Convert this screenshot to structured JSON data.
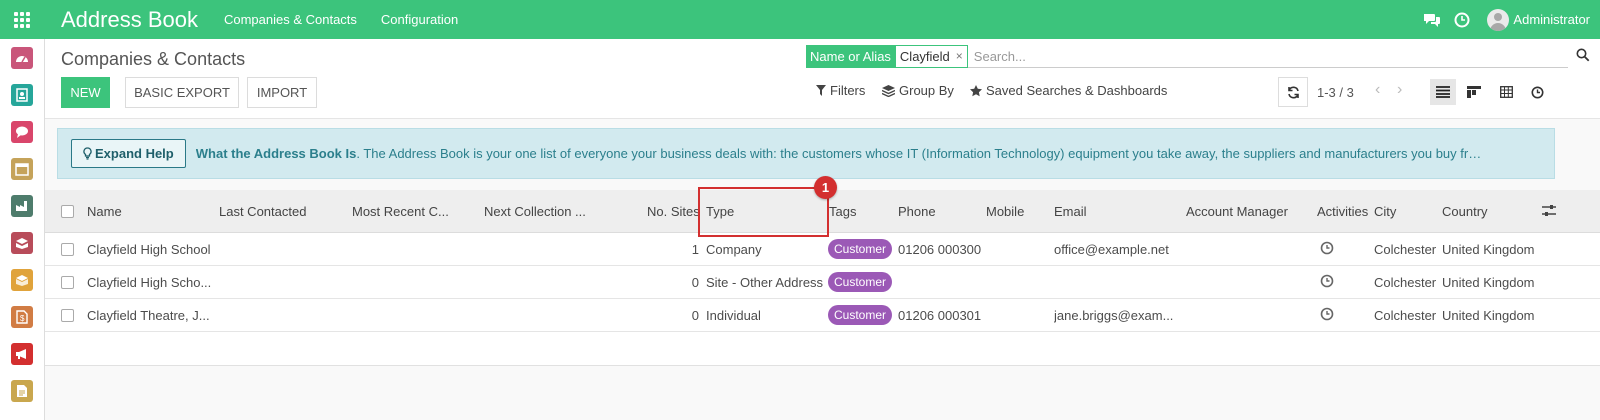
{
  "topbar": {
    "app_title": "Address Book",
    "menu": [
      "Companies & Contacts",
      "Configuration"
    ],
    "user_name": "Administrator"
  },
  "sidebar": {
    "apps": [
      {
        "icon": "dashboard-icon",
        "color": "#c9567a"
      },
      {
        "icon": "contacts-icon",
        "color": "#26a69a"
      },
      {
        "icon": "discuss-icon",
        "color": "#d9466b"
      },
      {
        "icon": "calendar-icon",
        "color": "#c5a35a"
      },
      {
        "icon": "factory-icon",
        "color": "#4e7c6c"
      },
      {
        "icon": "inventory-icon",
        "color": "#b84c5a"
      },
      {
        "icon": "boxes-icon",
        "color": "#e0a33b"
      },
      {
        "icon": "invoice-icon",
        "color": "#d17c44"
      },
      {
        "icon": "megaphone-icon",
        "color": "#d32f2f"
      },
      {
        "icon": "document-icon",
        "color": "#c9a74e"
      }
    ]
  },
  "control_panel": {
    "title": "Companies & Contacts",
    "new_label": "NEW",
    "export_label": "BASIC EXPORT",
    "import_label": "IMPORT",
    "search": {
      "facet_label": "Name or Alias",
      "facet_value": "Clayfield",
      "facet_remove": "×",
      "placeholder": "Search..."
    },
    "filters_label": "Filters",
    "groupby_label": "Group By",
    "saved_label": "Saved Searches & Dashboards",
    "pager_value": "1-3 / 3"
  },
  "help": {
    "button_label": "Expand Help",
    "title": "What the Address Book Is",
    "text": ". The Address Book is your one list of everyone your business deals with: the customers whose IT (Information Technology) equipment you take away, the suppliers and manufacturers you buy from, the couriers who mo..."
  },
  "table": {
    "headers": {
      "name": "Name",
      "last_contacted": "Last Contacted",
      "most_recent": "Most Recent C...",
      "next_collection": "Next Collection ...",
      "no_sites": "No. Sites",
      "type": "Type",
      "tags": "Tags",
      "phone": "Phone",
      "mobile": "Mobile",
      "email": "Email",
      "account_manager": "Account Manager",
      "activities": "Activities",
      "city": "City",
      "country": "Country"
    },
    "rows": [
      {
        "name": "Clayfield High School",
        "no_sites": "1",
        "type": "Company",
        "tag": "Customer",
        "phone": "01206 000300",
        "email": "office@example.net",
        "city": "Colchester",
        "country": "United Kingdom"
      },
      {
        "name": "Clayfield High Scho...",
        "no_sites": "0",
        "type": "Site - Other Address",
        "tag": "Customer",
        "phone": "",
        "email": "",
        "city": "Colchester",
        "country": "United Kingdom"
      },
      {
        "name": "Clayfield Theatre, J...",
        "no_sites": "0",
        "type": "Individual",
        "tag": "Customer",
        "phone": "01206 000301",
        "email": "jane.briggs@exam...",
        "city": "Colchester",
        "country": "United Kingdom"
      }
    ]
  },
  "annotation": {
    "badge": "1"
  },
  "colors": {
    "brand": "#3cc47c",
    "tag": "#9b59b6",
    "highlight": "#d32f2f"
  }
}
